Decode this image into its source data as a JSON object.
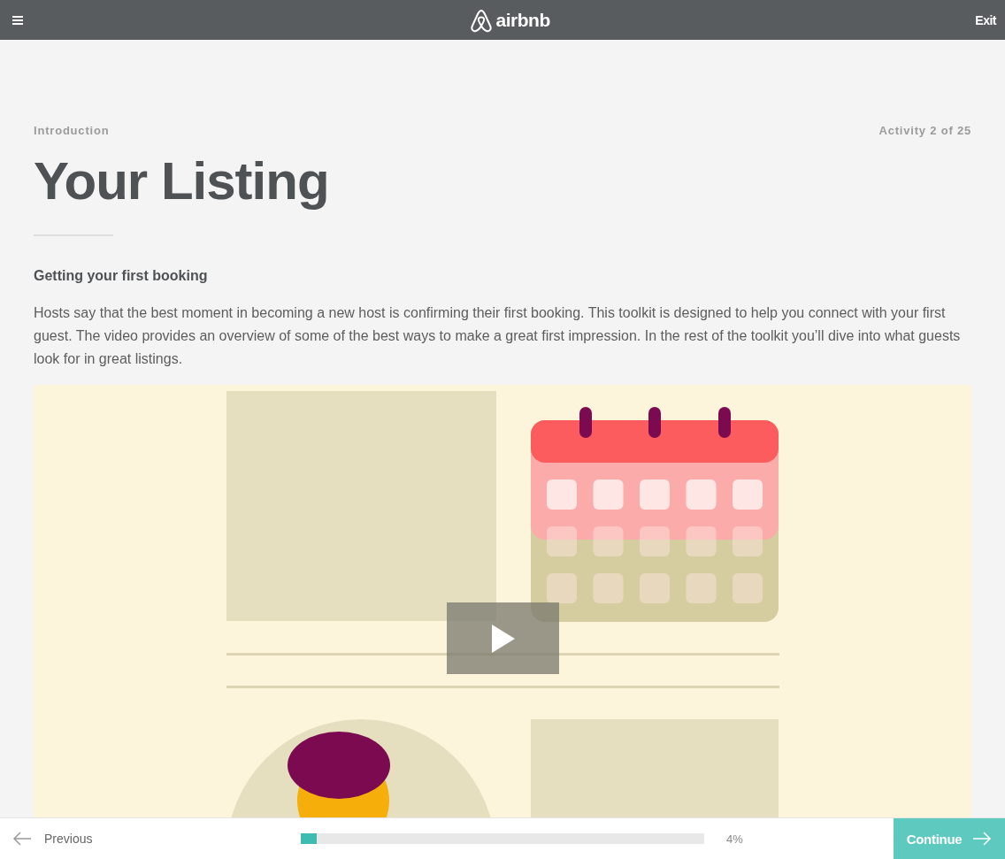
{
  "header": {
    "logo_text": "airbnb",
    "exit": "Exit"
  },
  "lesson": {
    "section": "Introduction",
    "activity": "Activity 2 of 25",
    "title": "Your Listing",
    "subtitle": "Getting your first booking",
    "body": "Hosts say that the best moment in becoming a new host is confirming their first booking. This toolkit is designed to help you connect with your first guest. The video provides an overview of some of the best ways to make a great first impression. In the rest of the toolkit you’ll dive into what guests look for in great listings."
  },
  "footer": {
    "previous": "Previous",
    "progress": {
      "level": 0.04,
      "reading": "4%"
    },
    "continue": "Continue"
  }
}
